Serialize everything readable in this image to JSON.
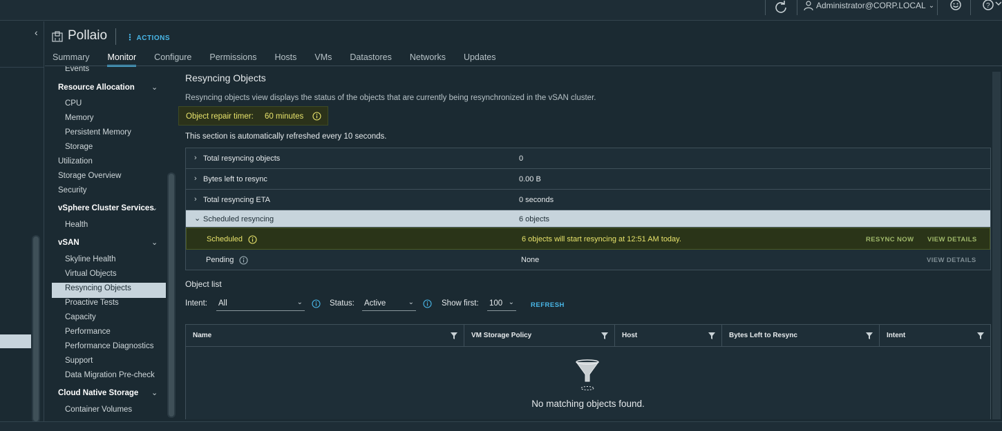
{
  "topbar": {
    "user": "Administrator@CORP.LOCAL"
  },
  "header": {
    "title": "Pollaio",
    "actions_label": "ACTIONS",
    "tabs": [
      "Summary",
      "Monitor",
      "Configure",
      "Permissions",
      "Hosts",
      "VMs",
      "Datastores",
      "Networks",
      "Updates"
    ],
    "active_tab": "Monitor"
  },
  "nav": {
    "cut_top": "Events",
    "resource_allocation": "Resource Allocation",
    "cpu": "CPU",
    "memory": "Memory",
    "persistent_memory": "Persistent Memory",
    "storage": "Storage",
    "utilization": "Utilization",
    "storage_overview": "Storage Overview",
    "security": "Security",
    "vsphere_cluster_services": "vSphere Cluster Services",
    "health": "Health",
    "vsan": "vSAN",
    "skyline_health": "Skyline Health",
    "virtual_objects": "Virtual Objects",
    "resyncing_objects": "Resyncing Objects",
    "proactive_tests": "Proactive Tests",
    "capacity": "Capacity",
    "performance": "Performance",
    "performance_diagnostics": "Performance Diagnostics",
    "support": "Support",
    "data_migration": "Data Migration Pre-check",
    "cloud_native_storage": "Cloud Native Storage",
    "container_volumes": "Container Volumes"
  },
  "content": {
    "title": "Resyncing Objects",
    "description": "Resyncing objects view displays the status of the objects that are currently being resynchronized in the vSAN cluster.",
    "timer_label": "Object repair timer:",
    "timer_value": "60 minutes",
    "refresh_note": "This section is automatically refreshed every 10 seconds.",
    "summary": {
      "total_label": "Total resyncing objects",
      "total_value": "0",
      "bytes_label": "Bytes left to resync",
      "bytes_value": "0.00 B",
      "eta_label": "Total resyncing ETA",
      "eta_value": "0 seconds",
      "scheduled_label": "Scheduled resyncing",
      "scheduled_value": "6 objects",
      "sched_sub_label": "Scheduled",
      "sched_sub_value": "6 objects will start resyncing at 12:51 AM today.",
      "resync_now": "RESYNC NOW",
      "view_details": "VIEW DETAILS",
      "pending_label": "Pending",
      "pending_value": "None",
      "pending_view_details": "VIEW DETAILS"
    },
    "object_list_title": "Object list",
    "filters": {
      "intent_label": "Intent:",
      "intent_value": "All",
      "status_label": "Status:",
      "status_value": "Active",
      "show_first_label": "Show first:",
      "show_first_value": "100",
      "refresh": "REFRESH"
    },
    "grid": {
      "columns": [
        "Name",
        "VM Storage Policy",
        "Host",
        "Bytes Left to Resync",
        "Intent"
      ],
      "empty_text": "No matching objects found."
    }
  }
}
